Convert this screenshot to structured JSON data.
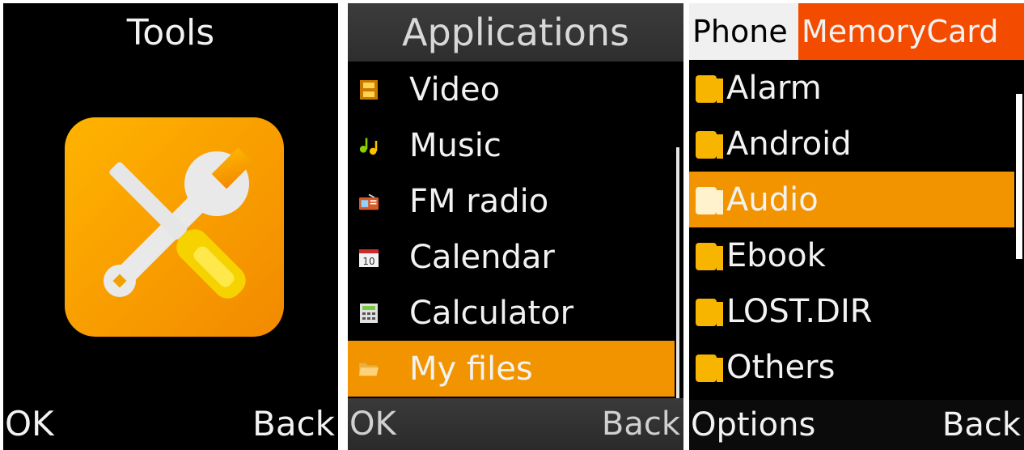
{
  "tools_screen": {
    "title": "Tools",
    "icon": "tools-icon",
    "softkeys": {
      "left": "OK",
      "right": "Back"
    }
  },
  "applications_screen": {
    "title": "Applications",
    "items": [
      {
        "label": "Video",
        "icon": "video-icon"
      },
      {
        "label": "Music",
        "icon": "music-icon"
      },
      {
        "label": "FM radio",
        "icon": "radio-icon"
      },
      {
        "label": "Calendar",
        "icon": "calendar-icon"
      },
      {
        "label": "Calculator",
        "icon": "calculator-icon"
      },
      {
        "label": "My files",
        "icon": "folder-icon",
        "selected": true
      }
    ],
    "softkeys": {
      "left": "OK",
      "right": "Back"
    }
  },
  "files_screen": {
    "tabs": [
      {
        "label": "Phone",
        "active": false
      },
      {
        "label": "MemoryCard",
        "active": true
      }
    ],
    "items": [
      {
        "label": "Alarm"
      },
      {
        "label": "Android"
      },
      {
        "label": "Audio",
        "selected": true
      },
      {
        "label": "Ebook"
      },
      {
        "label": "LOST.DIR"
      },
      {
        "label": "Others"
      }
    ],
    "softkeys": {
      "left": "Options",
      "right": "Back"
    }
  },
  "colors": {
    "selection": "#f29400",
    "active_tab": "#f34c00",
    "folder": "#f7b500"
  }
}
